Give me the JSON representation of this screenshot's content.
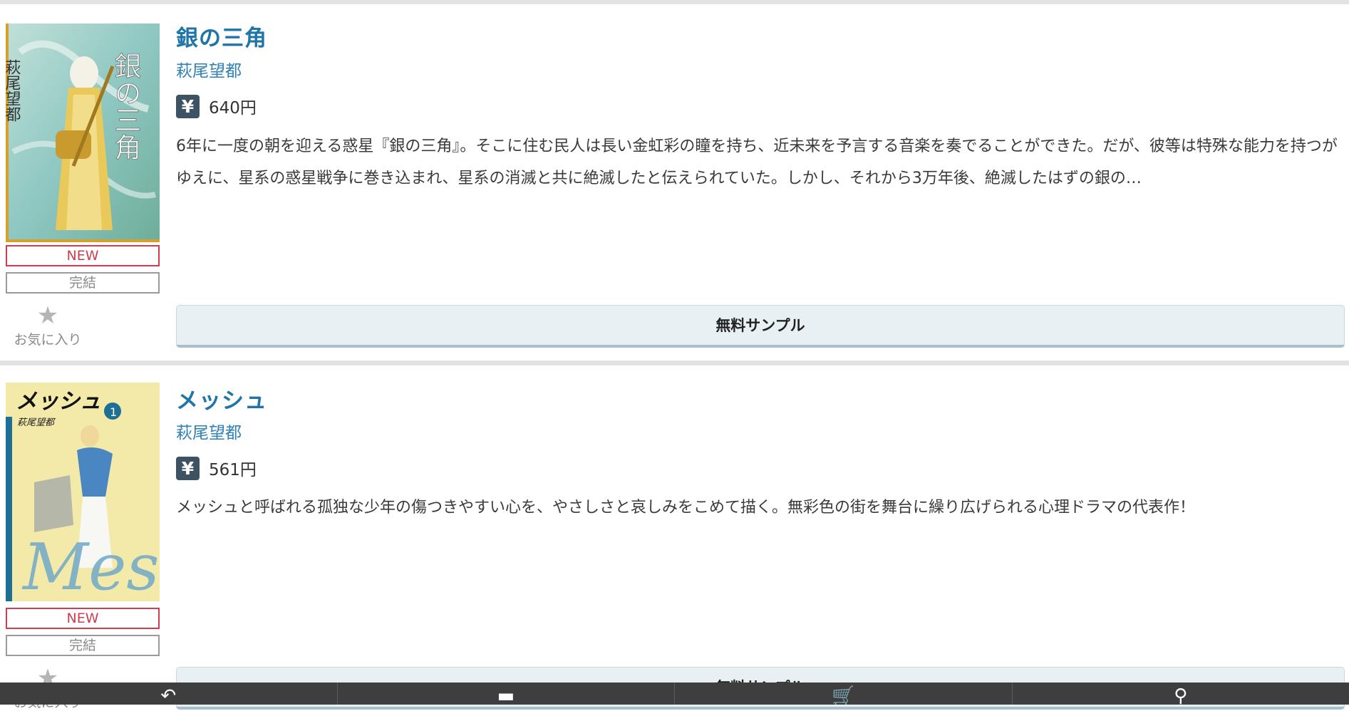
{
  "books": [
    {
      "title": "銀の三角",
      "author": "萩尾望都",
      "currency_icon": "yen-icon",
      "currency_symbol": "¥",
      "price": "640円",
      "description": "6年に一度の朝を迎える惑星『銀の三角』。そこに住む民人は長い金虹彩の瞳を持ち、近未来を予言する音楽を奏でることができた。だが、彼等は特殊な能力を持つがゆえに、星系の惑星戦争に巻き込まれ、星系の消滅と共に絶滅したと伝えられていた。しかし、それから3万年後、絶滅したはずの銀の…",
      "badge_new": "NEW",
      "badge_status": "完結",
      "favorite_label": "お気に入り",
      "sample_button": "無料サンプル",
      "cover": {
        "accent": "#c9a227",
        "border": "#9aa03c"
      }
    },
    {
      "title": "メッシュ",
      "author": "萩尾望都",
      "currency_icon": "yen-icon",
      "currency_symbol": "¥",
      "price": "561円",
      "description": "メッシュと呼ばれる孤独な少年の傷つきやすい心を、やさしさと哀しみをこめて描く。無彩色の街を舞台に繰り広げられる心理ドラマの代表作！",
      "badge_new": "NEW",
      "badge_status": "完結",
      "favorite_label": "お気に入り",
      "sample_button": "無料サンプル",
      "cover": {
        "accent": "#1e6f96",
        "bg": "#f3eaaa"
      }
    }
  ],
  "bottom_nav": [
    {
      "icon": "back-arrow-icon",
      "glyph": "↶"
    },
    {
      "icon": "menu-icon",
      "glyph": "▬"
    },
    {
      "icon": "cart-icon",
      "glyph": "🛒"
    },
    {
      "icon": "user-icon",
      "glyph": "⚲"
    }
  ],
  "colors": {
    "title": "#1f74a8",
    "author": "#2f81b5",
    "badge_new": "#cf3d4f",
    "yen_bg": "#3d5364",
    "button_bg": "#e9f0f4",
    "nav_bg": "#3e3e3e"
  }
}
